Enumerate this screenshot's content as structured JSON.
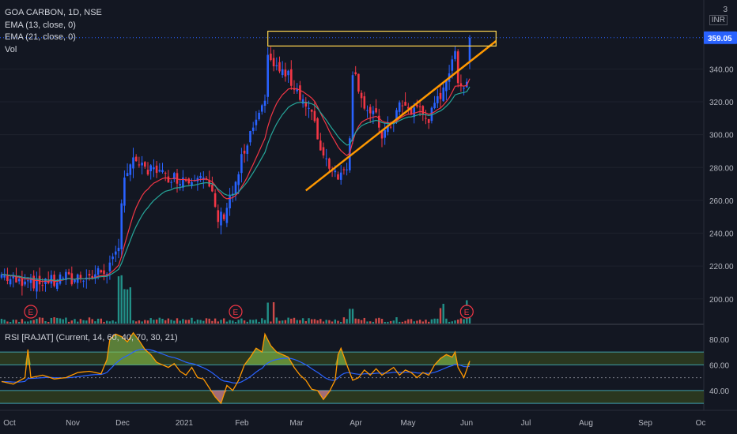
{
  "legend": {
    "title": "GOA CARBON, 1D, NSE",
    "ema13": "EMA (13, close, 0)",
    "ema21": "EMA (21, close, 0)",
    "vol": "Vol",
    "rsi": "RSI [RAJAT] (Current, 14, 60, 40, 70, 30, 21)"
  },
  "currency": {
    "top": "3",
    "label": "INR"
  },
  "price_label": "359.05",
  "earnings_marker": "E",
  "colors": {
    "up": "#2962ff",
    "down": "#f23645",
    "ema13": "#f23645",
    "ema21": "#26a69a",
    "triangle": "#ff9800",
    "resistance": "#ffd54f",
    "price_tag": "#2962ff",
    "rsi_line": "#ff9800",
    "rsi_bull_fill": "#8bc34a",
    "rsi_bear_fill": "#f48fb1",
    "rsi_ma": "#2962ff",
    "rsi_band": "#4dd0e1"
  },
  "chart_data": {
    "type": "candlestick",
    "x_tick_labels": [
      "Oct",
      "Nov",
      "Dec",
      "2021",
      "Feb",
      "Mar",
      "Apr",
      "May",
      "Jun",
      "Jul",
      "Aug",
      "Sep",
      "Oc"
    ],
    "price_axis": {
      "ticks": [
        "340.00",
        "320.00",
        "300.00",
        "280.00",
        "260.00",
        "240.00",
        "220.00",
        "200.00"
      ],
      "range": [
        185,
        382
      ]
    },
    "rsi_axis": {
      "ticks": [
        "80.00",
        "60.00",
        "40.00"
      ],
      "range": [
        27,
        91
      ],
      "levels": [
        30,
        40,
        60,
        70
      ]
    },
    "last_price": 359.05,
    "earnings_months": [
      "Oct",
      "Feb",
      "Jun"
    ],
    "price_path": [
      [
        0,
        215
      ],
      [
        3,
        212
      ],
      [
        6,
        210
      ],
      [
        9,
        214
      ],
      [
        12,
        208
      ],
      [
        15,
        212
      ],
      [
        18,
        210
      ],
      [
        21,
        214
      ],
      [
        24,
        211
      ],
      [
        27,
        215
      ],
      [
        30,
        213
      ],
      [
        33,
        216
      ],
      [
        36,
        218
      ],
      [
        38,
        222
      ],
      [
        40,
        230
      ],
      [
        41,
        262
      ],
      [
        42,
        275
      ],
      [
        44,
        280
      ],
      [
        46,
        285
      ],
      [
        48,
        279
      ],
      [
        50,
        276
      ],
      [
        52,
        282
      ],
      [
        54,
        277
      ],
      [
        56,
        274
      ],
      [
        58,
        275
      ],
      [
        60,
        273
      ],
      [
        62,
        274
      ],
      [
        64,
        272
      ],
      [
        66,
        276
      ],
      [
        68,
        278
      ],
      [
        70,
        271
      ],
      [
        72,
        262
      ],
      [
        74,
        248
      ],
      [
        76,
        252
      ],
      [
        78,
        262
      ],
      [
        80,
        268
      ],
      [
        82,
        285
      ],
      [
        84,
        292
      ],
      [
        86,
        305
      ],
      [
        88,
        310
      ],
      [
        90,
        318
      ],
      [
        91,
        352
      ],
      [
        92,
        345
      ],
      [
        94,
        340
      ],
      [
        96,
        338
      ],
      [
        98,
        335
      ],
      [
        100,
        330
      ],
      [
        102,
        325
      ],
      [
        104,
        318
      ],
      [
        106,
        312
      ],
      [
        108,
        298
      ],
      [
        110,
        288
      ],
      [
        112,
        282
      ],
      [
        114,
        278
      ],
      [
        116,
        275
      ],
      [
        118,
        282
      ],
      [
        119,
        300
      ],
      [
        120,
        340
      ],
      [
        122,
        330
      ],
      [
        124,
        318
      ],
      [
        126,
        312
      ],
      [
        128,
        310
      ],
      [
        130,
        300
      ],
      [
        132,
        302
      ],
      [
        134,
        310
      ],
      [
        136,
        318
      ],
      [
        138,
        316
      ],
      [
        140,
        314
      ],
      [
        142,
        318
      ],
      [
        144,
        312
      ],
      [
        146,
        310
      ],
      [
        148,
        316
      ],
      [
        150,
        325
      ],
      [
        152,
        335
      ],
      [
        154,
        342
      ],
      [
        155,
        350
      ],
      [
        156,
        335
      ],
      [
        158,
        330
      ],
      [
        159,
        332
      ],
      [
        160,
        348
      ]
    ],
    "triangle": {
      "support": [
        [
          104,
          266
        ],
        [
          169,
          357
        ]
      ],
      "resistance_band": [
        [
          91,
          356
        ],
        [
          169,
          359
        ]
      ]
    },
    "rsi_path": [
      [
        0,
        47
      ],
      [
        4,
        45
      ],
      [
        8,
        50
      ],
      [
        9,
        72
      ],
      [
        10,
        50
      ],
      [
        14,
        52
      ],
      [
        18,
        49
      ],
      [
        22,
        50
      ],
      [
        26,
        54
      ],
      [
        30,
        55
      ],
      [
        34,
        53
      ],
      [
        36,
        64
      ],
      [
        37,
        80
      ],
      [
        39,
        84
      ],
      [
        41,
        82
      ],
      [
        43,
        78
      ],
      [
        45,
        85
      ],
      [
        47,
        79
      ],
      [
        49,
        72
      ],
      [
        51,
        68
      ],
      [
        53,
        62
      ],
      [
        55,
        60
      ],
      [
        57,
        58
      ],
      [
        59,
        61
      ],
      [
        61,
        55
      ],
      [
        63,
        52
      ],
      [
        65,
        58
      ],
      [
        67,
        50
      ],
      [
        69,
        49
      ],
      [
        71,
        42
      ],
      [
        73,
        35
      ],
      [
        75,
        30
      ],
      [
        77,
        44
      ],
      [
        79,
        40
      ],
      [
        81,
        48
      ],
      [
        83,
        60
      ],
      [
        85,
        66
      ],
      [
        87,
        73
      ],
      [
        89,
        70
      ],
      [
        90,
        84
      ],
      [
        92,
        75
      ],
      [
        94,
        70
      ],
      [
        96,
        68
      ],
      [
        98,
        66
      ],
      [
        100,
        58
      ],
      [
        102,
        52
      ],
      [
        104,
        48
      ],
      [
        106,
        41
      ],
      [
        108,
        40
      ],
      [
        110,
        33
      ],
      [
        112,
        39
      ],
      [
        114,
        48
      ],
      [
        115,
        68
      ],
      [
        116,
        73
      ],
      [
        118,
        60
      ],
      [
        120,
        48
      ],
      [
        122,
        50
      ],
      [
        124,
        56
      ],
      [
        126,
        52
      ],
      [
        128,
        57
      ],
      [
        130,
        52
      ],
      [
        132,
        55
      ],
      [
        134,
        58
      ],
      [
        136,
        52
      ],
      [
        138,
        56
      ],
      [
        140,
        54
      ],
      [
        142,
        50
      ],
      [
        144,
        54
      ],
      [
        146,
        52
      ],
      [
        148,
        60
      ],
      [
        150,
        65
      ],
      [
        152,
        68
      ],
      [
        154,
        66
      ],
      [
        155,
        70
      ],
      [
        156,
        58
      ],
      [
        158,
        50
      ],
      [
        160,
        63
      ]
    ]
  }
}
